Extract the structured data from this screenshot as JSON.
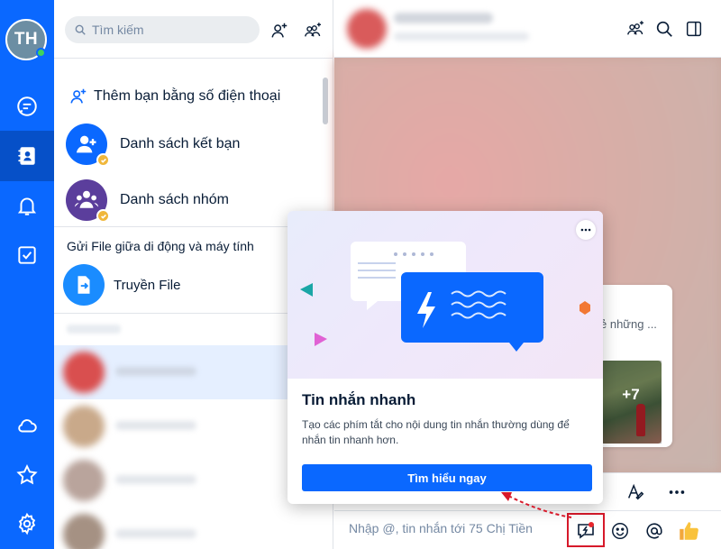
{
  "user": {
    "initials": "TH"
  },
  "search": {
    "placeholder": "Tìm kiếm"
  },
  "contacts_menu": {
    "add_by_phone": "Thêm bạn bằng số điện thoại",
    "friend_list": "Danh sách kết bạn",
    "group_list": "Danh sách nhóm"
  },
  "file_transfer": {
    "section_title": "Gửi File giữa di động và máy tính",
    "label": "Truyền File"
  },
  "popover": {
    "title": "Tin nhắn nhanh",
    "description": "Tạo các phím tắt cho nội dung tin nhắn thường dùng để nhắn tin nhanh hơn.",
    "button_label": "Tìm hiểu ngay"
  },
  "chat": {
    "card_text": "ẻ những ...",
    "photo_more": "+7",
    "input_placeholder": "Nhập @, tin nhắn tới 75 Chị Tiền"
  },
  "colors": {
    "brand_blue": "#0a68ff",
    "nav_active": "#0650c8",
    "highlight_red": "#d7192a",
    "badge_gold": "#f0b73b"
  },
  "icons": {
    "rail": [
      "chat-icon",
      "contacts-icon",
      "bell-icon",
      "todo-icon",
      "cloud-icon",
      "star-icon",
      "settings-icon"
    ],
    "toolbar": [
      "text-format-icon",
      "more-icon"
    ],
    "input": [
      "quick-message-icon",
      "emoji-icon",
      "mention-icon",
      "thumbs-up-icon"
    ]
  }
}
